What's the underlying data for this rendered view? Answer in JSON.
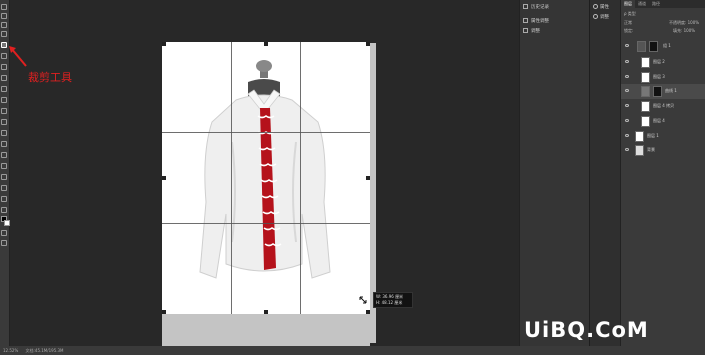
{
  "annotation": {
    "label": "裁剪工具"
  },
  "size_tooltip": {
    "width": "W: 36.96 厘米",
    "height": "H: 48.12 厘米"
  },
  "statusbar": {
    "zoom": "12.52%",
    "doc": "文档:45.1M/195.3M"
  },
  "mid_panel": {
    "items": [
      {
        "label": "历史记录"
      },
      {
        "label": "属性调整"
      },
      {
        "label": "调整"
      }
    ]
  },
  "icon_col": {
    "items": [
      {
        "label": "属性"
      },
      {
        "label": "调整"
      }
    ]
  },
  "layers": {
    "tabs": [
      "图层",
      "通道",
      "路径"
    ],
    "kind_label": "ρ 类型",
    "blend_mode": "正常",
    "opacity_label": "不透明度: 100%",
    "lock_label": "锁定:",
    "fill_label": "填充: 100%",
    "rows": [
      {
        "name": "组 1"
      },
      {
        "name": "图层 2"
      },
      {
        "name": "图层 3"
      },
      {
        "name": "曲线 1"
      },
      {
        "name": "图层 4 拷贝"
      },
      {
        "name": "图层 4"
      },
      {
        "name": "图层 1"
      },
      {
        "name": "背景"
      }
    ]
  },
  "watermark": {
    "text": "UiBQ.CoM"
  },
  "colors": {
    "shirt_red": "#b5121b",
    "annotation_red": "#e02020"
  }
}
